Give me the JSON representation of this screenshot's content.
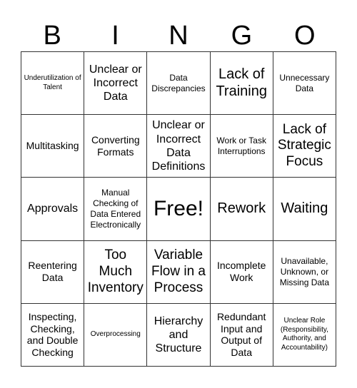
{
  "header": {
    "letters": [
      "B",
      "I",
      "N",
      "G",
      "O"
    ]
  },
  "grid": {
    "cells": [
      [
        "Underutilization of Talent",
        "Unclear or Incorrect Data",
        "Data Discrepancies",
        "Lack of Training",
        "Unnecessary Data"
      ],
      [
        "Multitasking",
        "Converting Formats",
        "Unclear or Incorrect Data Definitions",
        "Work or Task Interruptions",
        "Lack of Strategic Focus"
      ],
      [
        "Approvals",
        "Manual Checking of Data Entered Electronically",
        "Free!",
        "Rework",
        "Waiting"
      ],
      [
        "Reentering Data",
        "Too Much Inventory",
        "Variable Flow in a Process",
        "Incomplete Work",
        "Unavailable, Unknown, or Missing Data"
      ],
      [
        "Inspecting, Checking, and Double Checking",
        "Overprocessing",
        "Hierarchy and Structure",
        "Redundant Input and Output of Data",
        "Unclear Role (Responsibility, Authority, and Accountability)"
      ]
    ]
  }
}
